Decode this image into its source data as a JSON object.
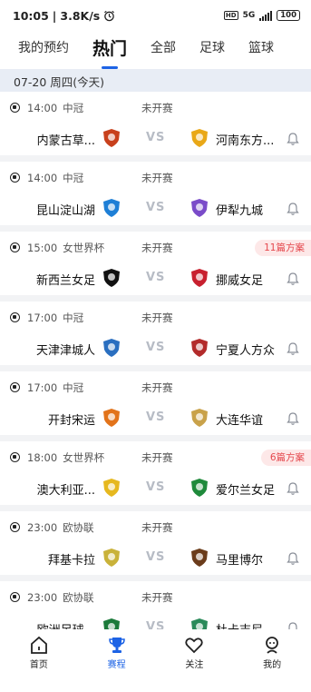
{
  "status_bar": {
    "time": "10:05",
    "net_speed": "3.8K/s",
    "hd": "HD",
    "network": "5G",
    "battery": "100"
  },
  "tabs": [
    {
      "label": "我的预约",
      "active": false
    },
    {
      "label": "热门",
      "active": true
    },
    {
      "label": "全部",
      "active": false
    },
    {
      "label": "足球",
      "active": false
    },
    {
      "label": "篮球",
      "active": false
    }
  ],
  "date_header": "07-20 周四(今天)",
  "vs_text": "VS",
  "matches": [
    {
      "time": "14:00",
      "league": "中冠",
      "status": "未开赛",
      "home": "内蒙古草...",
      "away": "河南东方...",
      "plans": "",
      "home_color": "#c8401c",
      "away_color": "#e9a817"
    },
    {
      "time": "14:00",
      "league": "中冠",
      "status": "未开赛",
      "home": "昆山淀山湖",
      "away": "伊犁九城",
      "plans": "",
      "home_color": "#1e7fd6",
      "away_color": "#7a4bc9"
    },
    {
      "time": "15:00",
      "league": "女世界杯",
      "status": "未开赛",
      "home": "新西兰女足",
      "away": "挪威女足",
      "plans": "11篇方案",
      "home_color": "#111111",
      "away_color": "#c8202f"
    },
    {
      "time": "17:00",
      "league": "中冠",
      "status": "未开赛",
      "home": "天津津城人",
      "away": "宁夏人方众",
      "plans": "",
      "home_color": "#2a6fc0",
      "away_color": "#b32b2b"
    },
    {
      "time": "17:00",
      "league": "中冠",
      "status": "未开赛",
      "home": "开封宋运",
      "away": "大连华谊",
      "plans": "",
      "home_color": "#e2731a",
      "away_color": "#c9a24a"
    },
    {
      "time": "18:00",
      "league": "女世界杯",
      "status": "未开赛",
      "home": "澳大利亚...",
      "away": "爱尔兰女足",
      "plans": "6篇方案",
      "home_color": "#e6b81f",
      "away_color": "#1f8a3b"
    },
    {
      "time": "23:00",
      "league": "欧协联",
      "status": "未开赛",
      "home": "拜基卡拉",
      "away": "马里博尔",
      "plans": "",
      "home_color": "#c9b23a",
      "away_color": "#6b3c1b"
    },
    {
      "time": "23:00",
      "league": "欧协联",
      "status": "未开赛",
      "home": "欧洲足球...",
      "away": "杜卡吉尼",
      "plans": "",
      "home_color": "#1b7a3a",
      "away_color": "#2a8a5a"
    }
  ],
  "bottom_nav": [
    {
      "label": "首页",
      "icon": "home-icon",
      "active": false
    },
    {
      "label": "赛程",
      "icon": "trophy-icon",
      "active": true
    },
    {
      "label": "关注",
      "icon": "heart-icon",
      "active": false
    },
    {
      "label": "我的",
      "icon": "profile-icon",
      "active": false
    }
  ],
  "colors": {
    "accent": "#1d63e5",
    "plans_text": "#e5484d",
    "plans_bg": "#fde8e8",
    "date_bg": "#e8edf5",
    "vs": "#b7bcc5"
  }
}
